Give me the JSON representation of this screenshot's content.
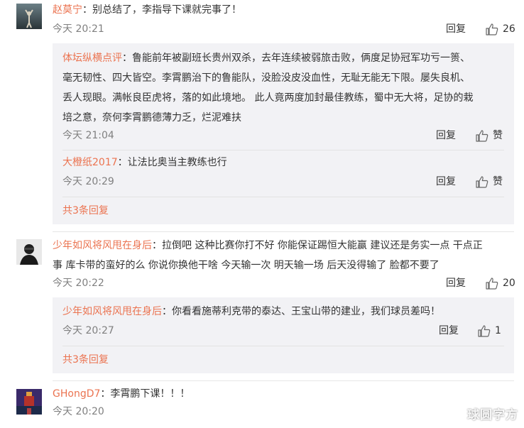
{
  "comments": [
    {
      "name": "赵莫宁",
      "text_lines": [
        "：别总结了，李指导下课就完事了！"
      ],
      "time": "今天 20:21",
      "reply_label": "回复",
      "likes": "26",
      "sub_replies": [
        {
          "name": "体坛纵横点评",
          "text_lines": [
            "：鲁能前年被副班长贵州双杀，去年连续被弱旅击败，俩度足协冠军功亏一篑、",
            "毫无韧性、四大皆空。李霄鹏治下的鲁能队，没脸没皮没血性，无耻无能无下限。屡失良机、",
            "丢人现眼。满帐良臣虎将，落的如此境地。 此人竟两度加封最佳教练，蜀中无大将，足协的栽",
            "培之意，奈何李霄鹏德薄力乏，烂泥难扶"
          ],
          "time": "今天 21:04",
          "reply_label": "回复",
          "likes": "赞"
        },
        {
          "name": "大橙纸2017",
          "text_lines": [
            "：让法比奥当主教练也行"
          ],
          "time": "今天 20:29",
          "reply_label": "回复",
          "likes": "赞"
        }
      ],
      "more_label": "共3条回复"
    },
    {
      "name": "少年如风将风甩在身后",
      "text_lines": [
        "：拉倒吧 这种比赛你打不好 你能保证踢恒大能赢 建议还是务实一点 干点正",
        "事 库卡带的蛮好的么 你说你换他干啥 今天输一次 明天输一场 后天没得输了 脸都不要了"
      ],
      "time": "今天 20:22",
      "reply_label": "回复",
      "likes": "20",
      "sub_replies": [
        {
          "name": "少年如风将风甩在身后",
          "text_lines": [
            "：你看看施蒂利克带的泰达、王宝山带的建业，我们球员差吗！"
          ],
          "time": "今天 20:27",
          "reply_label": "回复",
          "likes": "1"
        }
      ],
      "more_label": "共3条回复"
    },
    {
      "name": "GHongD7",
      "text_lines": [
        "：李霄鹏下课！！！"
      ],
      "time": "今天 20:20"
    }
  ],
  "watermark": "球圆字方",
  "icons": {
    "like": "thumbs-up-icon"
  },
  "colors": {
    "name": "#eb7350",
    "time": "#808080",
    "reply_box": "#f2f2f5"
  }
}
